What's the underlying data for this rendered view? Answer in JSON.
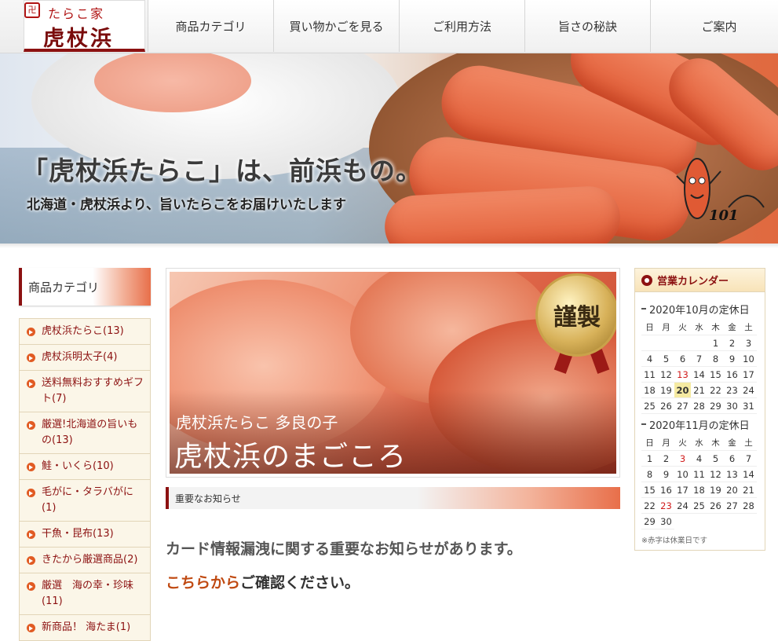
{
  "header": {
    "logo_small": "たらこ家",
    "logo_main": "虎杖浜",
    "nav": [
      "商品カテゴリ",
      "買い物かごを見る",
      "ご利用方法",
      "旨さの秘訣",
      "ご案内"
    ]
  },
  "hero": {
    "title": "「虎杖浜たらこ」は、前浜もの。",
    "subtitle": "北海道・虎杖浜より、旨いたらこをお届けいたします",
    "badge": "101"
  },
  "sidebar": {
    "heading": "商品カテゴリ",
    "items": [
      "虎杖浜たらこ(13)",
      "虎杖浜明太子(4)",
      "送料無料おすすめギフト(7)",
      "厳選!北海道の旨いもの(13)",
      "鮭・いくら(10)",
      "毛がに・タラバがに(1)",
      "干魚・昆布(13)",
      "きたから厳選商品(2)",
      "厳選　海の幸・珍味(11)",
      "新商品！ 海たま(1)"
    ]
  },
  "feature": {
    "line1": "虎杖浜たらこ 多良の子",
    "line2": "虎杖浜のまごころ",
    "medal": "謹製"
  },
  "notice": {
    "bar_label": "重要なお知らせ",
    "line1": "カード情報漏洩に関する重要なお知らせがあります。",
    "link": "こちらから",
    "line2_rest": "ご確認ください。"
  },
  "calendar": {
    "heading": "営業カレンダー",
    "weekdays": [
      "日",
      "月",
      "火",
      "水",
      "木",
      "金",
      "土"
    ],
    "months": [
      {
        "title": "2020年10月の定休日",
        "offset": 4,
        "days": 31,
        "holidays": [
          13
        ],
        "today": 20
      },
      {
        "title": "2020年11月の定休日",
        "offset": 0,
        "days": 30,
        "holidays": [
          3,
          23
        ],
        "today": null
      }
    ],
    "note": "※赤字は休業日です"
  },
  "colors": {
    "brand_red": "#8c1111",
    "link_orange": "#c04a12",
    "holiday_red": "#d11b1b",
    "today_bg": "#f5eaa2"
  }
}
